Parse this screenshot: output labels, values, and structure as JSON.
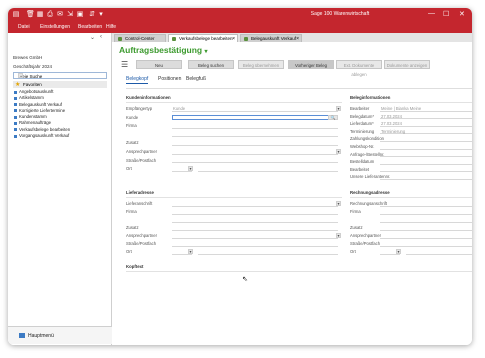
{
  "titlebar": {
    "app_title": "Sage 100 Warenwirtschaft",
    "controls": {
      "minimize": "—",
      "maximize": "☐",
      "close": "✕"
    }
  },
  "menu": [
    "Datei",
    "Einstellungen",
    "Bearbeiten",
    "Hilfe"
  ],
  "doc_tabs": [
    {
      "label": "Control-Center",
      "closable": false
    },
    {
      "label": "Verkaufsbelege bearbeiten",
      "closable": true
    },
    {
      "label": "Belegauskunft Verkauf",
      "closable": true
    }
  ],
  "sidebar": {
    "company": "Brewes GmbH",
    "fiscal_year": "Geschäftsjahr 2024",
    "search": "Freie Suche",
    "favorites": "Favoriten",
    "items": [
      "Angebotsauskunft",
      "Artikelstamm",
      "Belegauskunft Verkauf",
      "Korrigierte Liefertermine",
      "Kundenstamm",
      "Rahmenaufträge",
      "Verkaufsbelege bearbeiten",
      "Vorgangsauskunft Verkauf"
    ],
    "bottom": "Hauptmenü"
  },
  "main": {
    "title": "Auftragsbestätigung",
    "toolbar": {
      "new": "Neu",
      "search": "Beleg suchen",
      "take_over": "Beleg übernehmen",
      "prev": "Vorheriger Beleg",
      "files": "Ext. Dokumente ablegen",
      "show_docs": "Dokumente anzeigen"
    },
    "subtabs": [
      "Belegkopf",
      "Positionen",
      "Belegfuß"
    ],
    "sections": {
      "customer": "Kundeninformationen",
      "doc_info": "Beleginformationen",
      "delivery": "Lieferadresse",
      "billing": "Rechnungsadresse",
      "footer": "Kopftext"
    },
    "customer_fields": [
      {
        "label": "Empfängertyp",
        "value": "Kunde"
      },
      {
        "label": "Kunde",
        "value": ""
      },
      {
        "label": "Firma",
        "value": ""
      },
      {
        "label": "",
        "value": ""
      },
      {
        "label": "Zusatz",
        "value": ""
      },
      {
        "label": "Ansprechpartner",
        "value": ""
      },
      {
        "label": "Straße/Postfach",
        "value": ""
      },
      {
        "label": "Ort",
        "value": ""
      }
    ],
    "doc_fields": [
      {
        "label": "Bearbeiter",
        "value": "Meine | Bianka Meine"
      },
      {
        "label": "Belegdatum*",
        "value": "27.03.2024"
      },
      {
        "label": "Lieferdatum*",
        "value": "27.03.2024"
      },
      {
        "label": "Terminierung",
        "value": "Terminierung"
      },
      {
        "label": "Zahlungskondition",
        "value": ""
      },
      {
        "label": "Webshop-Nr.",
        "value": ""
      },
      {
        "label": "Anfrage-/Bestellnr.",
        "value": ""
      },
      {
        "label": "Bestelldatum",
        "value": ""
      },
      {
        "label": "Bearbeitet",
        "value": ""
      },
      {
        "label": "Unsere Lieferantennr.",
        "value": ""
      }
    ],
    "delivery_fields": [
      "Lieferanschrift",
      "Firma",
      "",
      "Zusatz",
      "Ansprechpartner",
      "Straße/Postfach",
      "Ort"
    ],
    "billing_fields": [
      "Rechnungsanschrift",
      "Firma",
      "",
      "Zusatz",
      "Ansprechpartner",
      "Straße/Postfach",
      "Ort"
    ]
  }
}
